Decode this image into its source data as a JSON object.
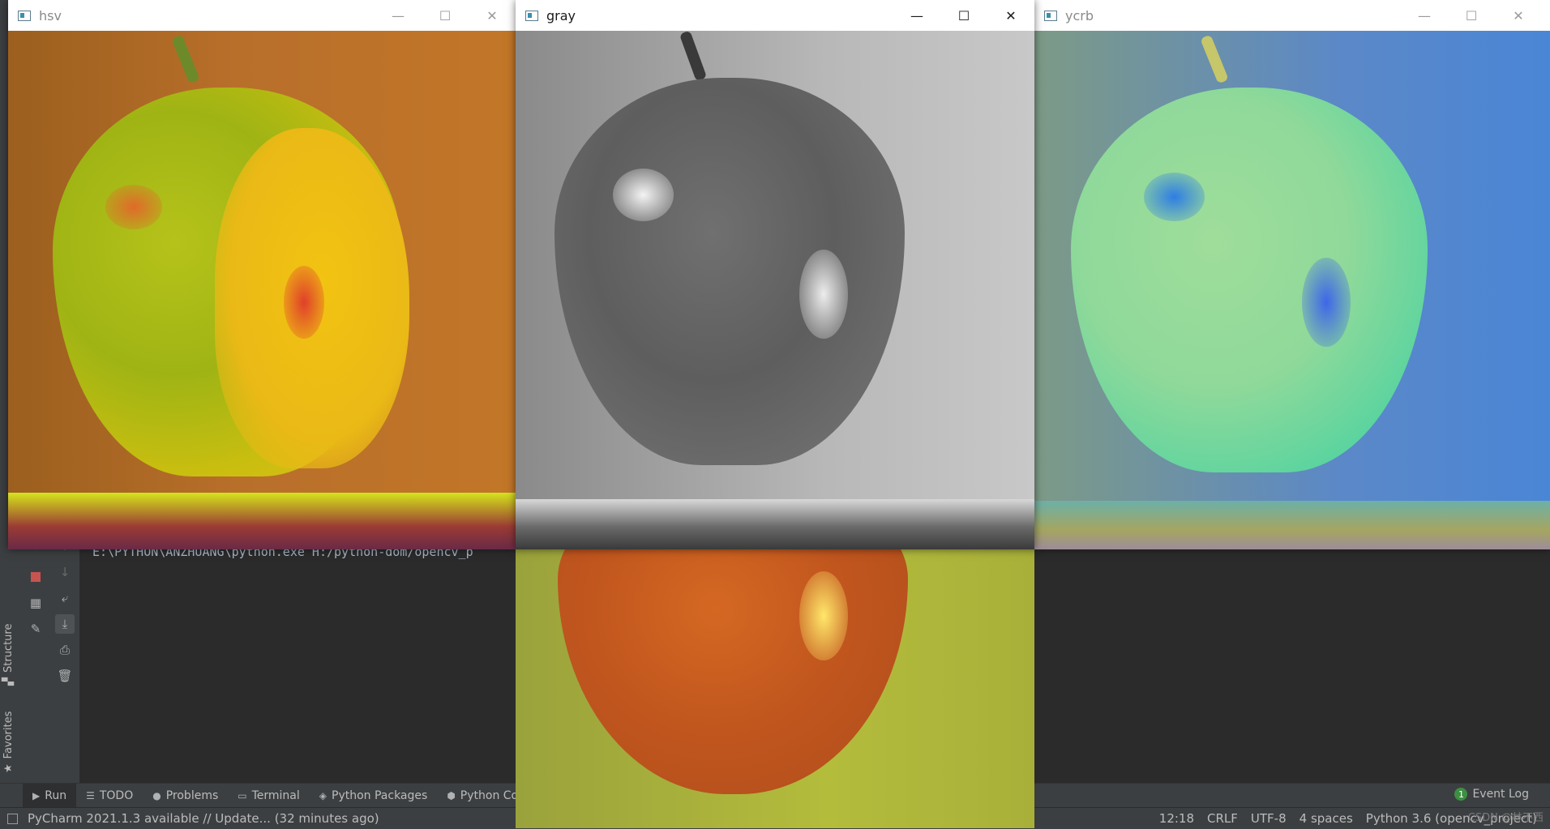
{
  "windows": {
    "hsv": {
      "title": "hsv"
    },
    "gray": {
      "title": "gray"
    },
    "ycrb": {
      "title": "ycrb"
    }
  },
  "ide": {
    "console_text": "E:\\PYTHON\\ANZHUANG\\python.exe H:/python-dom/opencv_p",
    "side_tabs": {
      "structure": "Structure",
      "favorites": "Favorites"
    },
    "bottom_tabs": [
      "Run",
      "TODO",
      "Problems",
      "Terminal",
      "Python Packages",
      "Python Co"
    ],
    "event_log": {
      "label": "Event Log",
      "count": "1"
    },
    "status": {
      "message": "PyCharm 2021.1.3 available // Update... (32 minutes ago)",
      "position": "12:18",
      "line_sep": "CRLF",
      "encoding": "UTF-8",
      "indent": "4 spaces",
      "interpreter": "Python 3.6 (opencv_project)"
    },
    "watermark": "CSDN @林不西"
  },
  "colors": {
    "ide_bg": "#2b2b2b",
    "ide_panel": "#3c3f41",
    "console_text": "#a9b7c6",
    "event_badge": "#3d8f42"
  }
}
